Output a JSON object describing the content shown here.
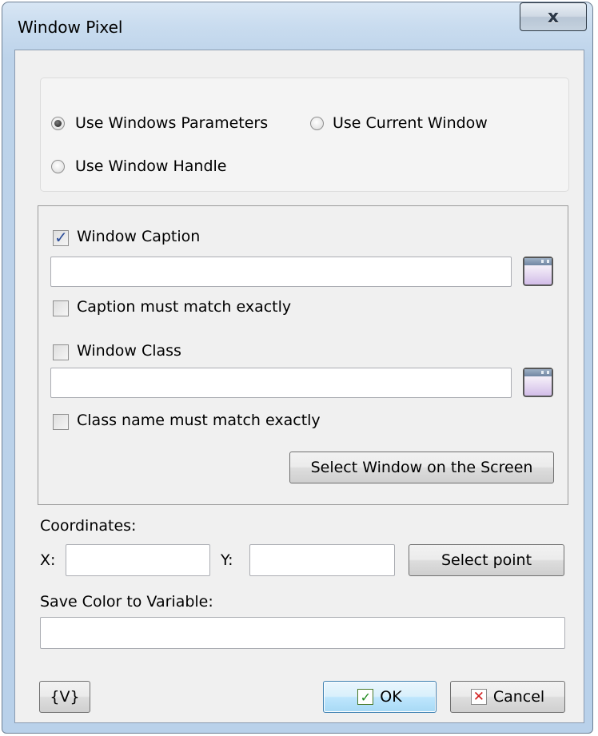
{
  "window": {
    "title": "Window Pixel",
    "close_glyph": "x"
  },
  "mode": {
    "options": [
      {
        "label": "Use Windows Parameters",
        "checked": true
      },
      {
        "label": "Use Current Window",
        "checked": false
      },
      {
        "label": "Use Window Handle",
        "checked": false
      }
    ]
  },
  "window_params": {
    "caption_label": "Window Caption",
    "caption_checked": true,
    "caption_value": "",
    "caption_exact_label": "Caption must match exactly",
    "caption_exact_checked": false,
    "class_label": "Window Class",
    "class_checked": false,
    "class_value": "",
    "class_exact_label": "Class name must match exactly",
    "class_exact_checked": false,
    "select_window_button": "Select Window on the Screen",
    "pick_icon": "window-picker-icon"
  },
  "coordinates": {
    "label": "Coordinates:",
    "x_label": "X:",
    "x_value": "",
    "y_label": "Y:",
    "y_value": "",
    "select_point_button": "Select point"
  },
  "variable": {
    "label": "Save Color to Variable:",
    "value": ""
  },
  "footer": {
    "variables_button": "{V}",
    "ok_button": "OK",
    "cancel_button": "Cancel"
  },
  "colors": {
    "frame": "#bdd3ea",
    "client": "#f0f0f0",
    "default_button": "#bee6fd"
  }
}
